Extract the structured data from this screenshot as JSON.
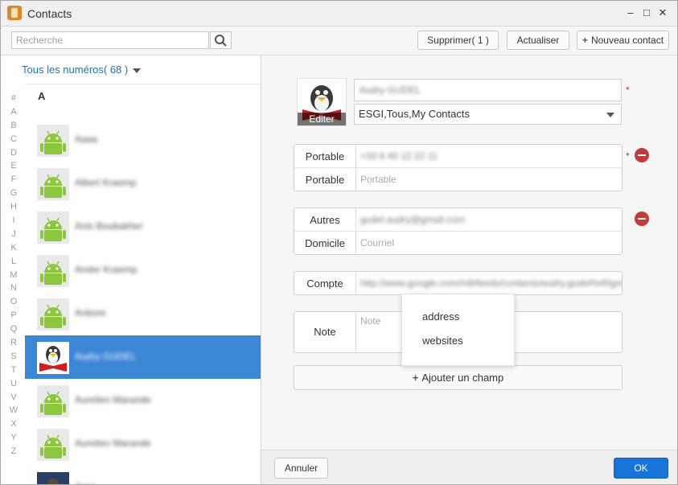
{
  "window": {
    "title": "Contacts",
    "controls": {
      "minimize": "–",
      "maximize": "□",
      "close": "✕"
    }
  },
  "toolbar": {
    "search_placeholder": "Recherche",
    "delete_label": "Supprimer( 1 )",
    "refresh_label": "Actualiser",
    "new_contact_label": "Nouveau contact",
    "new_contact_icon": "+"
  },
  "contact_list": {
    "group_header": "Tous les numéros( 68 )",
    "alphabet": [
      "#",
      "A",
      "B",
      "C",
      "D",
      "E",
      "F",
      "G",
      "H",
      "I",
      "J",
      "K",
      "L",
      "M",
      "N",
      "O",
      "P",
      "Q",
      "R",
      "S",
      "T",
      "U",
      "V",
      "W",
      "X",
      "Y",
      "Z"
    ],
    "section": "A",
    "contacts": [
      {
        "name": "Aaaa",
        "avatar": "android-avatar-icon",
        "selected": false
      },
      {
        "name": "Albert Kraemp",
        "avatar": "android-avatar-icon",
        "selected": false
      },
      {
        "name": "Anis Boubakher",
        "avatar": "android-avatar-icon",
        "selected": false
      },
      {
        "name": "Ander Kraemp",
        "avatar": "android-avatar-icon",
        "selected": false
      },
      {
        "name": "Anbore",
        "avatar": "android-avatar-icon",
        "selected": false
      },
      {
        "name": "Audry GUDEL",
        "avatar": "penguin-avatar-icon",
        "selected": true
      },
      {
        "name": "Aurelien Marande",
        "avatar": "android-avatar-icon",
        "selected": false
      },
      {
        "name": "Aurelien Marande",
        "avatar": "android-avatar-icon",
        "selected": false
      },
      {
        "name": "Ayse",
        "avatar": "photo-avatar-icon",
        "selected": false
      }
    ]
  },
  "editor": {
    "photo_edit_label": "Editer",
    "name_value": "Audry GUDEL",
    "groups_value": "ESGI,Tous,My Contacts",
    "required_mark": "*",
    "phones": [
      {
        "label": "Portable",
        "value": "+33 6 40 12 22 11",
        "placeholder": ""
      },
      {
        "label": "Portable",
        "value": "",
        "placeholder": "Portable"
      }
    ],
    "emails": [
      {
        "label": "Autres",
        "value": "gudel.audry@gmail.com",
        "placeholder": ""
      },
      {
        "label": "Domicile",
        "value": "",
        "placeholder": "Courriel"
      }
    ],
    "account": {
      "label": "Compte",
      "value": "http://www.google.com/m8/feeds/contacts/audry.gudel%40gmail.com"
    },
    "note": {
      "label": "Note",
      "placeholder": "Note"
    },
    "add_field_label": "Ajouter un champ",
    "add_field_icon": "+"
  },
  "popup": {
    "items": [
      "address",
      "websites"
    ]
  },
  "footer": {
    "cancel_label": "Annuler",
    "ok_label": "OK"
  },
  "colors": {
    "accent": "#3c86d6",
    "ok_button": "#1a73d9",
    "remove": "#c33c3c",
    "required": "#cc3333",
    "header_link": "#2f6fa8"
  }
}
